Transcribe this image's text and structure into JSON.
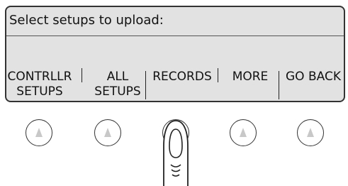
{
  "screen": {
    "title": "Select setups to upload:",
    "softkeys": [
      {
        "line1": "CONTRLLR",
        "line2": "SETUPS"
      },
      {
        "line1": "ALL",
        "line2": "SETUPS"
      },
      {
        "line1": "RECORDS",
        "line2": ""
      },
      {
        "line1": "MORE",
        "line2": ""
      },
      {
        "line1": "GO BACK",
        "line2": ""
      }
    ]
  },
  "hardware_buttons": [
    {
      "icon": "up-arrow-icon"
    },
    {
      "icon": "up-arrow-icon"
    },
    {
      "icon": "up-arrow-icon",
      "pressed": true
    },
    {
      "icon": "up-arrow-icon"
    },
    {
      "icon": "up-arrow-icon"
    }
  ],
  "colors": {
    "lcd_background": "#e2e2e2",
    "arrow": "#c8c8c8"
  }
}
